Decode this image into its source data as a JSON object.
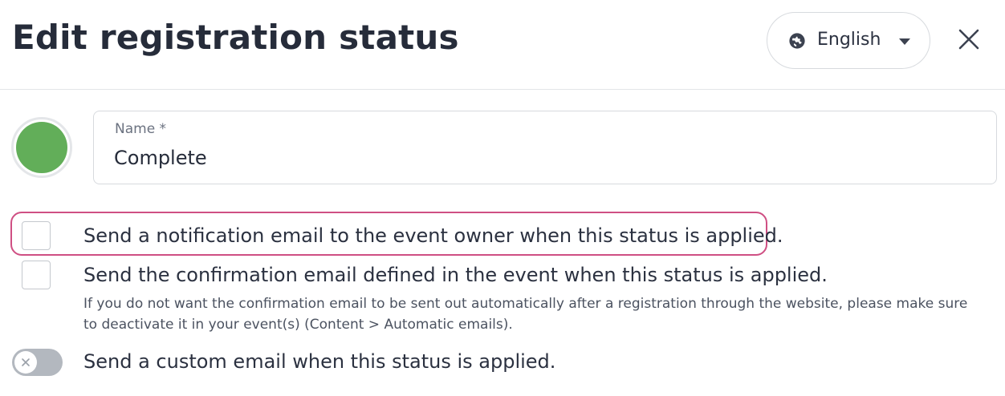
{
  "header": {
    "title": "Edit registration status",
    "language": {
      "selected": "English"
    }
  },
  "status": {
    "color": "#62ae59",
    "name_label": "Name *",
    "name_value": "Complete"
  },
  "options": {
    "notify_owner": {
      "label": "Send a notification email to the event owner when this status is applied.",
      "checked": false
    },
    "send_confirmation": {
      "label": "Send the confirmation email defined in the event when this status is applied.",
      "help": "If you do not want the confirmation email to be sent out automatically after a registration through the website, please make sure to deactivate it in your event(s) (Content > Automatic emails).",
      "checked": false
    },
    "custom_email": {
      "label": "Send a custom email when this status is applied.",
      "enabled": false
    }
  },
  "colors": {
    "highlight": "#cf4f83",
    "toggle_off": "#b3b8bf"
  },
  "icons": {
    "language": "globe-icon",
    "dropdown": "caret-down-icon",
    "close": "close-icon",
    "toggle": "x-icon"
  }
}
